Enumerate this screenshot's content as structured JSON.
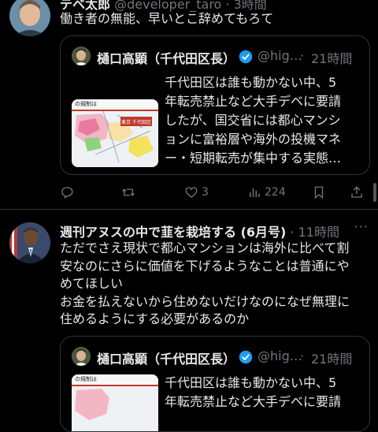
{
  "tweets": [
    {
      "author_name": "テベ太郎",
      "handle": "@developer_taro",
      "dot": "·",
      "time": "3時間",
      "text_lines": [
        "働き者の無能、早いとこ辞めてもろて"
      ],
      "quote": {
        "author_name": "樋口高顕（千代田区長）",
        "handle": "@hig…",
        "dot": "·",
        "time": "21時間",
        "thumb_caption": "の規制は",
        "thumb_tag": "東京 千代田区",
        "text_lines": [
          "千代田区は誰も動かない中、5",
          "年転売禁止など大手デベに要請",
          "したが、国交省には都心マンシ",
          "ョンに富裕層や海外の投機マネ",
          "ー・短期転売が集中する実態…"
        ]
      },
      "actions": {
        "reply": "",
        "retweet": "",
        "like": "3",
        "views": "224"
      }
    },
    {
      "author_name": "週刊アヌスの中で韮を栽培する (6月号)",
      "dot": "·",
      "time": "11時間",
      "text_lines": [
        "ただでさえ現状で都心マンションは海外に比べて割",
        "安なのにさらに価値を下げるようなことは普通にや",
        "めてほしい",
        "お金を払えないから住めないだけなのになぜ無理に",
        "住めるようにする必要があるのか"
      ],
      "quote": {
        "author_name": "樋口高顕（千代田区長）",
        "handle": "@hig…",
        "dot": "·",
        "time": "21時間",
        "thumb_caption": "の規制は",
        "text_lines": [
          "千代田区は誰も動かない中、5",
          "年転売禁止など大手デベに要請"
        ]
      }
    }
  ],
  "colors": {
    "background": "#000000",
    "text": "#e7e9ea",
    "muted": "#71767b",
    "border": "#2f3336",
    "verified": "#1d9bf0"
  },
  "icons": [
    "reply-icon",
    "retweet-icon",
    "like-icon",
    "views-icon",
    "bookmark-icon",
    "share-icon",
    "verified-icon",
    "more-icon"
  ]
}
